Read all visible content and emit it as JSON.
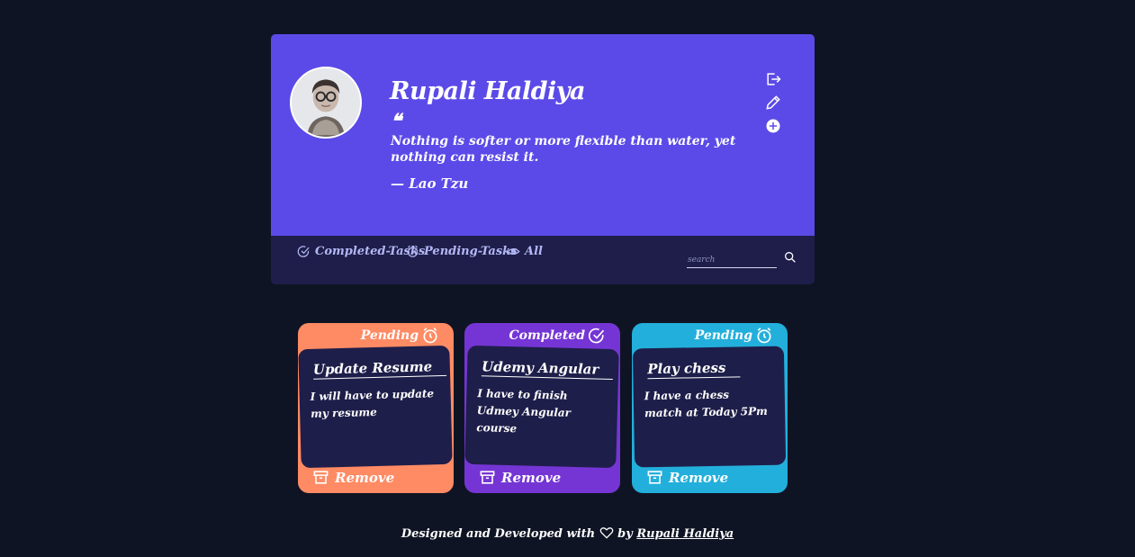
{
  "profile": {
    "name": "Rupali Haldiya",
    "quote_mark": "❝",
    "quote": "Nothing is softer or more flexible than water, yet nothing can resist it.",
    "author": "— Lao Tzu",
    "avatar_icon": "user-avatar",
    "actions": [
      "logout-icon",
      "edit-icon",
      "add-icon"
    ],
    "bg_color": "#5b4ae8"
  },
  "nav": {
    "items": [
      {
        "label": "Completed-Tasks",
        "icon": "check-circle-icon"
      },
      {
        "label": "Pending-Tasks",
        "icon": "alarm-clock-icon"
      },
      {
        "label": "All",
        "icon": "eye-icon"
      }
    ],
    "search_placeholder": "search",
    "bg_color": "#1f1e4a"
  },
  "cards": [
    {
      "status": "Pending",
      "status_icon": "alarm-clock-icon",
      "title": "Update Resume",
      "description": "I will have to update my resume",
      "remove_label": "Remove",
      "color": "#ff8b64"
    },
    {
      "status": "Completed",
      "status_icon": "check-circle-icon",
      "title": "Udemy Angular",
      "description": "I have to finish Udmey Angular course",
      "remove_label": "Remove",
      "color": "#7535d4"
    },
    {
      "status": "Pending",
      "status_icon": "alarm-clock-icon",
      "title": "Play chess",
      "description": "I have a chess match at Today 5Pm",
      "remove_label": "Remove",
      "color": "#23afdb"
    }
  ],
  "footer": {
    "prefix": "Designed and Developed with",
    "by": "by",
    "author_link": "Rupali Haldiya"
  }
}
